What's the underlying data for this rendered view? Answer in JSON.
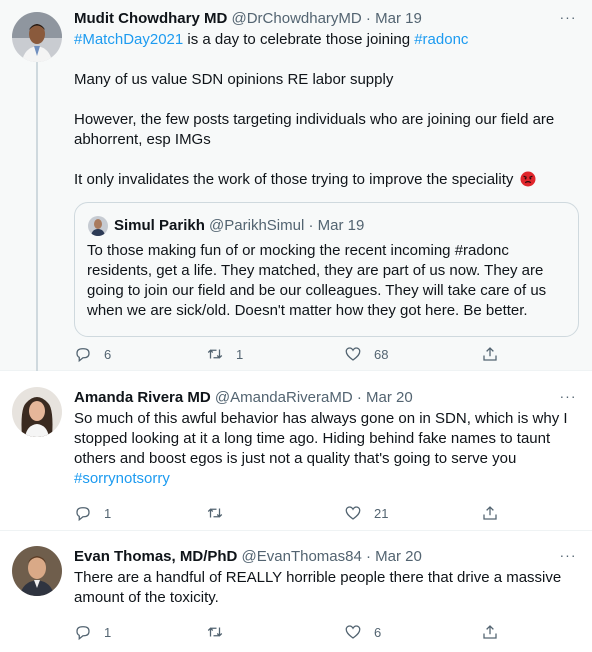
{
  "tweets": [
    {
      "name": "Mudit Chowdhary MD",
      "handle": "@DrChowdharyMD",
      "date": "Mar 19",
      "more": "···",
      "hashtag1": "#MatchDay2021",
      "text1_mid": " is a day to celebrate those joining ",
      "hashtag2": "#radonc",
      "para2": "Many of us value SDN opinions RE labor supply",
      "para3": "However, the few posts targeting individuals who are joining our field are abhorrent, esp IMGs",
      "para4": "It only invalidates the work of those trying to improve the speciality",
      "replies": "6",
      "retweets": "1",
      "likes": "68",
      "quote": {
        "name": "Simul Parikh",
        "handle": "@ParikhSimul",
        "date": "Mar 19",
        "text": "To those making fun of or mocking the recent incoming #radonc residents, get a life. They matched, they are part of us now. They are going to join our field and be our colleagues. They will take care of us when we are sick/old. Doesn't matter how they got here. Be better."
      }
    },
    {
      "name": "Amanda Rivera MD",
      "handle": "@AmandaRiveraMD",
      "date": "Mar 20",
      "more": "···",
      "text": "So much of this awful behavior has always gone on in SDN, which is why I stopped looking at it a long time ago. Hiding behind fake names to taunt others and boost egos is just not a quality that's going to serve you",
      "hashtag": "#sorrynotsorry",
      "replies": "1",
      "retweets": "",
      "likes": "21"
    },
    {
      "name": "Evan Thomas, MD/PhD",
      "handle": "@EvanThomas84",
      "date": "Mar 20",
      "more": "···",
      "text": "There are a handful of REALLY horrible people there that drive a massive amount of the toxicity.",
      "replies": "1",
      "retweets": "",
      "likes": "6"
    }
  ],
  "separator": " · ",
  "colors": {
    "link": "#1d9bf0",
    "muted": "#536471",
    "highlight_bg": "#f7f9f9",
    "border": "#cfd9de"
  },
  "icons": [
    "reply-icon",
    "retweet-icon",
    "like-icon",
    "share-icon",
    "more-icon",
    "angry-face-icon"
  ]
}
